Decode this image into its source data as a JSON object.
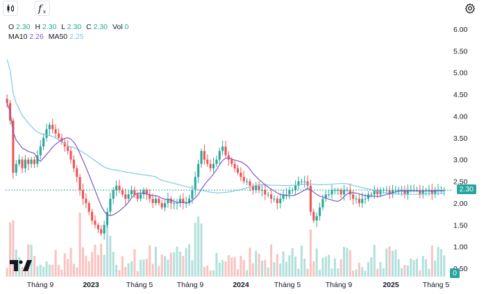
{
  "toolbar": {
    "candles_icon": "candlestick-icon",
    "indicators_icon": "function-icon",
    "settings_icon": "gear-icon"
  },
  "legend": {
    "o_label": "O",
    "o_value": "2.30",
    "h_label": "H",
    "h_value": "2.30",
    "l_label": "L",
    "l_value": "2.30",
    "c_label": "C",
    "c_value": "2.30",
    "vol_label": "Vol",
    "vol_value": "0",
    "ma10_label": "MA10",
    "ma10_value": "2.26",
    "ma50_label": "MA50",
    "ma50_value": "2.25"
  },
  "price_badge": "2.30",
  "volume_badge": "0",
  "colors": {
    "up": "#26a69a",
    "down": "#ef5350",
    "ma10": "#7e57c2",
    "ma50": "#7ec8e3"
  },
  "chart_data": {
    "type": "candlestick",
    "y_ticks": [
      "6.00",
      "5.50",
      "5.00",
      "4.50",
      "4.00",
      "3.50",
      "3.00",
      "2.50",
      "2.00",
      "1.50",
      "1.00",
      "0.50"
    ],
    "ylim": [
      0.5,
      6.0
    ],
    "x_ticks": [
      {
        "label": "Tháng 9",
        "bold": false
      },
      {
        "label": "2023",
        "bold": true
      },
      {
        "label": "Tháng 5",
        "bold": false
      },
      {
        "label": "Tháng 9",
        "bold": false
      },
      {
        "label": "2024",
        "bold": true
      },
      {
        "label": "Tháng 5",
        "bold": false
      },
      {
        "label": "Tháng 9",
        "bold": false
      },
      {
        "label": "2025",
        "bold": true
      },
      {
        "label": "Tháng 5",
        "bold": false
      }
    ],
    "last_price": 2.3,
    "close_series": [
      4.3,
      3.9,
      2.7,
      2.9,
      3.0,
      2.8,
      3.0,
      2.9,
      3.0,
      2.9,
      3.1,
      3.3,
      3.5,
      3.7,
      3.8,
      3.7,
      3.6,
      3.5,
      3.4,
      3.3,
      3.2,
      3.0,
      2.8,
      2.6,
      2.3,
      2.1,
      2.0,
      1.8,
      1.6,
      1.5,
      1.4,
      1.3,
      1.5,
      1.8,
      2.1,
      2.3,
      2.4,
      2.3,
      2.2,
      2.1,
      2.2,
      2.3,
      2.2,
      2.1,
      2.2,
      2.3,
      2.2,
      2.1,
      2.0,
      2.1,
      2.0,
      1.9,
      2.0,
      2.1,
      2.0,
      2.0,
      2.0,
      2.1,
      2.0,
      2.0,
      2.1,
      2.3,
      2.6,
      2.9,
      3.2,
      3.0,
      2.9,
      2.8,
      2.9,
      3.0,
      3.2,
      3.3,
      3.1,
      3.0,
      2.9,
      2.8,
      2.7,
      2.6,
      2.5,
      2.5,
      2.4,
      2.3,
      2.4,
      2.3,
      2.3,
      2.2,
      2.2,
      2.1,
      2.1,
      2.0,
      2.1,
      2.2,
      2.2,
      2.3,
      2.3,
      2.4,
      2.5,
      2.5,
      2.5,
      2.4,
      1.8,
      1.6,
      1.7,
      1.9,
      2.1,
      2.2,
      2.2,
      2.3,
      2.3,
      2.3,
      2.2,
      2.3,
      2.3,
      2.2,
      2.1,
      2.1,
      2.0,
      2.1,
      2.1,
      2.2,
      2.2,
      2.3,
      2.2,
      2.3,
      2.3,
      2.3,
      2.2,
      2.3,
      2.3,
      2.3,
      2.3,
      2.2,
      2.3,
      2.3,
      2.3,
      2.3,
      2.2,
      2.3,
      2.3,
      2.3,
      2.2,
      2.3,
      2.3,
      2.3,
      2.3
    ],
    "volume_scale": "relative"
  }
}
